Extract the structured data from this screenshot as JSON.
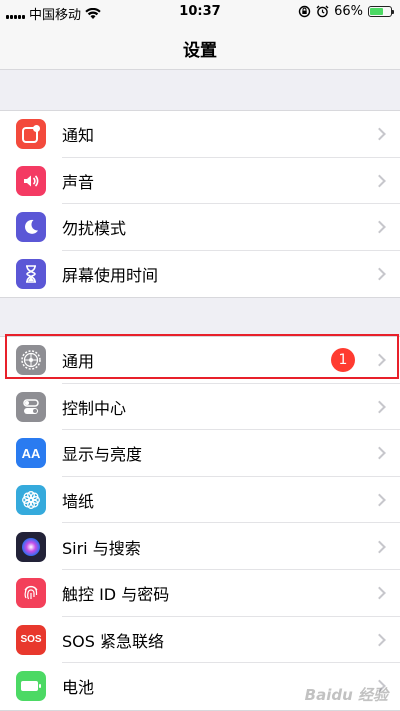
{
  "status_bar": {
    "carrier": "中国移动",
    "time": "10:37",
    "battery": "66%",
    "battery_level": 0.66
  },
  "nav": {
    "title": "设置"
  },
  "groups": [
    {
      "items": [
        {
          "label": "通知",
          "icon": "notifications-icon",
          "color": "#f34a3c"
        },
        {
          "label": "声音",
          "icon": "sound-icon",
          "color": "#f43a63"
        },
        {
          "label": "勿扰模式",
          "icon": "do-not-disturb-icon",
          "color": "#5b57d6"
        },
        {
          "label": "屏幕使用时间",
          "icon": "screen-time-icon",
          "color": "#5b57d6"
        }
      ]
    },
    {
      "items": [
        {
          "label": "通用",
          "icon": "gear-icon",
          "color": "#8e8e93",
          "badge": "1",
          "highlighted": true
        },
        {
          "label": "控制中心",
          "icon": "control-center-icon",
          "color": "#8e8e93"
        },
        {
          "label": "显示与亮度",
          "icon": "display-brightness-icon",
          "color": "#2a7bf0",
          "icon_text": "AA"
        },
        {
          "label": "墙纸",
          "icon": "wallpaper-icon",
          "color": "#35aadc"
        },
        {
          "label": "Siri 与搜索",
          "icon": "siri-icon",
          "color": "#222238"
        },
        {
          "label": "触控 ID 与密码",
          "icon": "touch-id-icon",
          "color": "#f3405a"
        },
        {
          "label": "SOS 紧急联络",
          "icon": "sos-icon",
          "color": "#e8382d",
          "icon_text": "SOS"
        },
        {
          "label": "电池",
          "icon": "battery-icon",
          "color": "#4cd964"
        }
      ]
    }
  ],
  "watermark": "Baidu 经验"
}
